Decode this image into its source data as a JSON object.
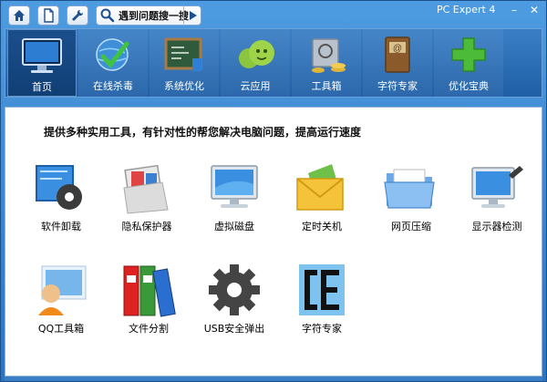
{
  "window": {
    "app_title": "PC Expert 4",
    "search_text": "遇到问题搜一搜",
    "minimize": "–",
    "close": "✕"
  },
  "nav": {
    "items": [
      {
        "label": "首页",
        "icon": "monitor-icon",
        "active": true
      },
      {
        "label": "在线杀毒",
        "icon": "globe-shield-icon"
      },
      {
        "label": "系统优化",
        "icon": "chalkboard-icon"
      },
      {
        "label": "云应用",
        "icon": "cloud-smiley-icon"
      },
      {
        "label": "工具箱",
        "icon": "safe-coins-icon"
      },
      {
        "label": "字符专家",
        "icon": "address-book-icon"
      },
      {
        "label": "优化宝典",
        "icon": "green-plus-icon"
      }
    ]
  },
  "content": {
    "description": "提供多种实用工具，有针对性的帮您解决电脑问题，提高运行速度",
    "tools": [
      {
        "label": "软件卸载",
        "icon": "software-uninstall-icon"
      },
      {
        "label": "隐私保护器",
        "icon": "privacy-folder-icon"
      },
      {
        "label": "虚拟磁盘",
        "icon": "virtual-disk-monitor-icon"
      },
      {
        "label": "定时关机",
        "icon": "mail-envelope-icon"
      },
      {
        "label": "网页压缩",
        "icon": "folder-icon"
      },
      {
        "label": "显示器检测",
        "icon": "monitor-check-icon"
      },
      {
        "label": "QQ工具箱",
        "icon": "qq-user-icon"
      },
      {
        "label": "文件分割",
        "icon": "binders-icon"
      },
      {
        "label": "USB安全弹出",
        "icon": "gear-icon"
      },
      {
        "label": "字符专家",
        "icon": "character-expert-icon"
      }
    ]
  }
}
